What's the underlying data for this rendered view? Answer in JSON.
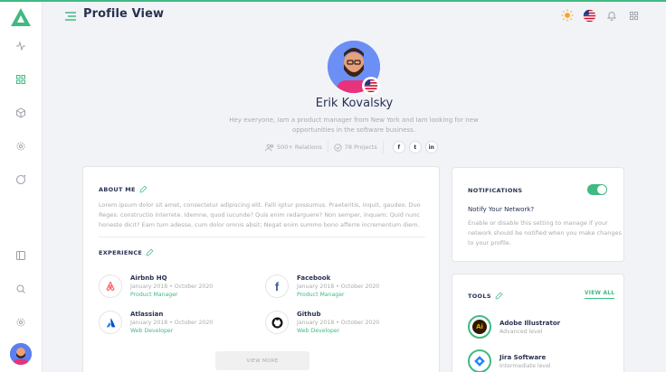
{
  "header": {
    "title": "Profile View"
  },
  "profile": {
    "name": "Erik Kovalsky",
    "bio": "Hey everyone, Iam a product manager from New York and Iam looking for new opportunities in the software business.",
    "relations": "500+ Relations",
    "projects": "78 Projects",
    "socials": [
      "f",
      "t",
      "in"
    ]
  },
  "about": {
    "title": "ABOUT ME",
    "text": "Lorem ipsum dolor sit amet, consectetur adipiscing elit. Falli igitur possumus. Praeteritis, inquit, gaudeo. Duo Reges: constructio interrete. Idemne, quod iucunde? Quis enim redarguere? Non semper, inquam; Quid nunc honeste dicit? Eam tum adesse, cum dolor omnis absit; Negat enim summo bono afferre incrementum diem."
  },
  "experience": {
    "title": "EXPERIENCE",
    "items": [
      {
        "company": "Airbnb HQ",
        "start": "January 2018",
        "end": "October 2020",
        "role": "Product Manager",
        "icon": "airbnb-logo-icon"
      },
      {
        "company": "Facebook",
        "start": "January 2018",
        "end": "October 2020",
        "role": "Product Manager",
        "icon": "facebook-logo-icon"
      },
      {
        "company": "Atlassian",
        "start": "January 2018",
        "end": "October 2020",
        "role": "Web Developer",
        "icon": "atlassian-logo-icon"
      },
      {
        "company": "Github",
        "start": "January 2018",
        "end": "October 2020",
        "role": "Web Developer",
        "icon": "github-logo-icon"
      }
    ],
    "view_more": "VIEW MORE"
  },
  "notifications": {
    "title": "NOTIFICATIONS",
    "enabled": true,
    "subtitle": "Notify Your Network?",
    "description": "Enable or disable this setting to manage if your network should be notified when you make changes to your profile."
  },
  "tools": {
    "title": "TOOLS",
    "view_all": "VIEW ALL",
    "items": [
      {
        "name": "Adobe Illustrator",
        "level": "Advanced level",
        "icon": "adobe-illustrator-icon"
      },
      {
        "name": "Jira Software",
        "level": "Intermediate level",
        "icon": "jira-icon"
      }
    ]
  },
  "colors": {
    "accent": "#41b983",
    "text": "#283252",
    "muted": "#a9abac"
  }
}
